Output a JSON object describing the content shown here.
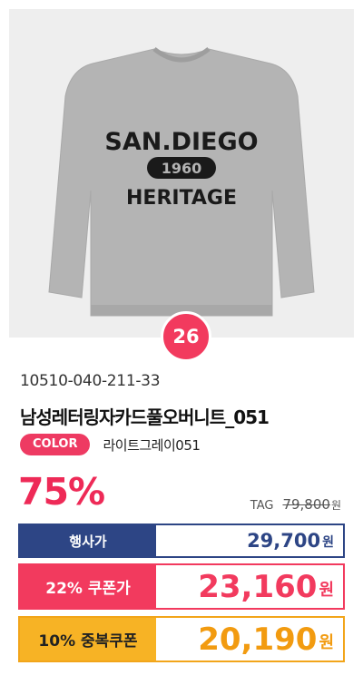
{
  "product": {
    "rank": "26",
    "code": "10510-040-211-33",
    "name": "남성레터링자카드풀오버니트_051",
    "color_label": "COLOR",
    "color_value": "라이트그레이051",
    "sweater_print": {
      "line1": "SAN.DIEGO",
      "line2": "1960",
      "line3": "HERITAGE"
    }
  },
  "pricing": {
    "discount": "75%",
    "tag_label": "TAG",
    "tag_price": "79,800",
    "unit": "원",
    "event_label": "행사가",
    "event_price": "29,700",
    "coupon_label": "22% 쿠폰가",
    "coupon_price": "23,160",
    "dup_coupon_label": "10% 중복쿠폰",
    "dup_coupon_price": "20,190"
  },
  "colors": {
    "accent_pink": "#f23a5e",
    "navy": "#2d4585",
    "orange": "#f2a51a"
  }
}
